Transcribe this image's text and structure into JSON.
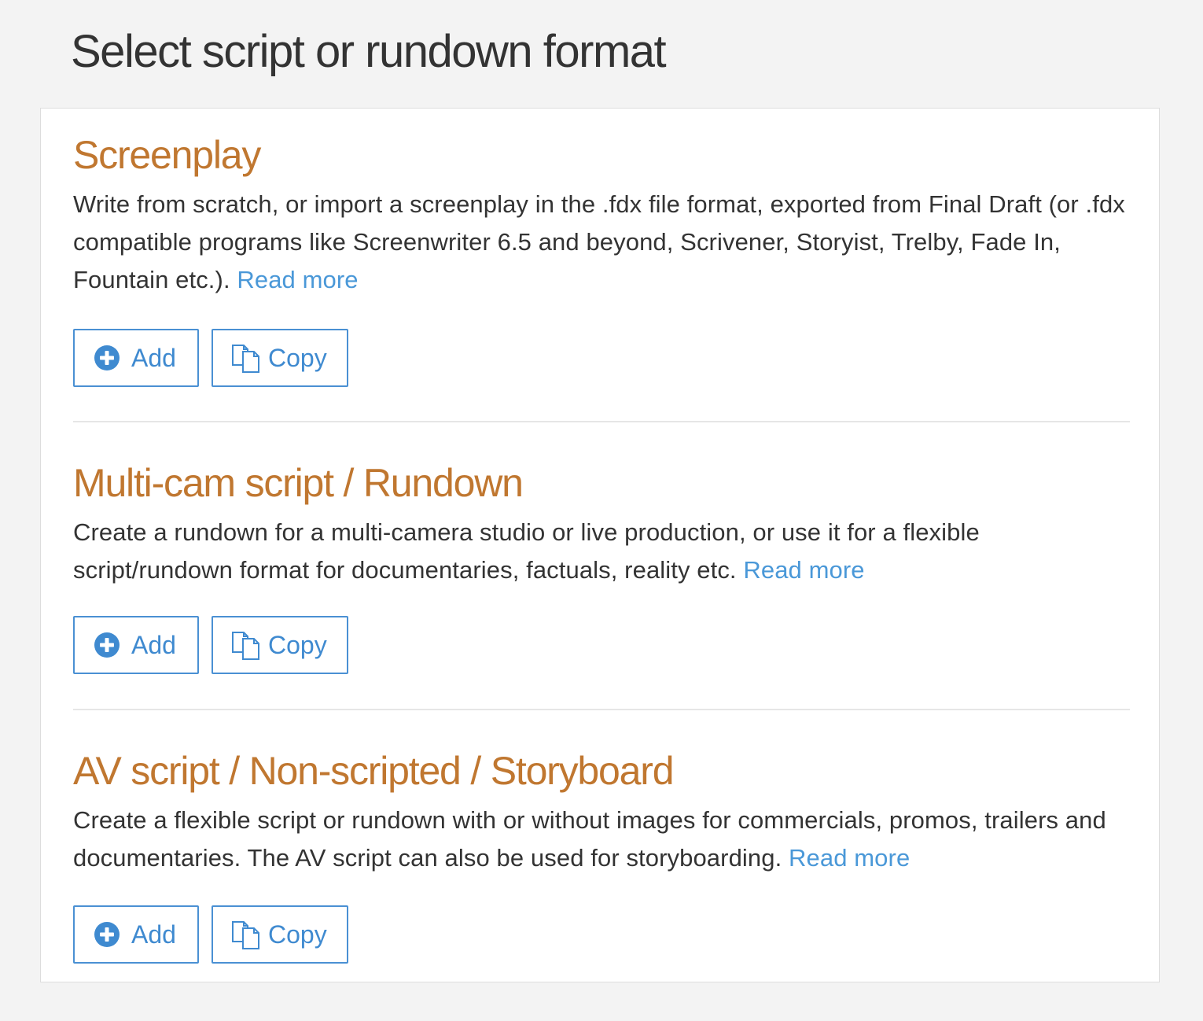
{
  "page": {
    "title": "Select script or rundown format"
  },
  "sections": [
    {
      "title": "Screenplay",
      "description": "Write from scratch, or import a screenplay in the .fdx file format, exported from Final Draft (or .fdx compatible programs like Screenwriter 6.5 and beyond, Scrivener, Storyist, Trelby, Fade In, Fountain etc.).",
      "read_more": "Read more",
      "add_label": "Add",
      "copy_label": "Copy"
    },
    {
      "title": "Multi-cam script / Rundown",
      "description": "Create a rundown for a multi-camera studio or live production, or use it for a flexible script/rundown format for documentaries, factuals, reality etc.",
      "read_more": "Read more",
      "add_label": "Add",
      "copy_label": "Copy"
    },
    {
      "title": "AV script / Non-scripted / Storyboard",
      "description": "Create a flexible script or rundown with or without images for commercials, promos, trailers and documentaries. The AV script can also be used for storyboarding.",
      "read_more": "Read more",
      "add_label": "Add",
      "copy_label": "Copy"
    }
  ],
  "icons": {
    "add": "plus-circle-icon",
    "copy": "copy-icon"
  },
  "colors": {
    "heading_accent": "#c07730",
    "link": "#4a98d8",
    "button_border": "#4a90d3",
    "background": "#f3f3f3"
  }
}
